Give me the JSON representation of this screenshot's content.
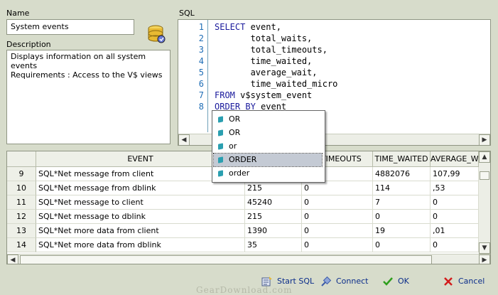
{
  "labels": {
    "name": "Name",
    "description": "Description",
    "sql": "SQL"
  },
  "name_value": "System events",
  "description_lines": [
    "Displays information on all system events",
    "Requirements : Access to the V$ views"
  ],
  "sql_lines": [
    {
      "num": "1",
      "kw": "SELECT",
      "rest": " event,"
    },
    {
      "num": "2",
      "kw": "",
      "rest": "       total_waits,"
    },
    {
      "num": "3",
      "kw": "",
      "rest": "       total_timeouts,"
    },
    {
      "num": "4",
      "kw": "",
      "rest": "       time_waited,"
    },
    {
      "num": "5",
      "kw": "",
      "rest": "       average_wait,"
    },
    {
      "num": "6",
      "kw": "",
      "rest": "       time_waited_micro"
    },
    {
      "num": "7",
      "kw": "FROM",
      "rest": " v$system_event"
    },
    {
      "num": "8",
      "kw": "ORDER BY",
      "rest": " event"
    }
  ],
  "grid": {
    "headers": [
      "",
      "EVENT",
      "",
      "L_TIMEOUTS",
      "TIME_WAITED",
      "AVERAGE_W"
    ],
    "rows": [
      {
        "n": "9",
        "cells": [
          "SQL*Net message from client",
          "",
          "",
          "4882076",
          "107,99"
        ]
      },
      {
        "n": "10",
        "cells": [
          "SQL*Net message from dblink",
          "215",
          "0",
          "114",
          ",53"
        ]
      },
      {
        "n": "11",
        "cells": [
          "SQL*Net message to client",
          "45240",
          "0",
          "7",
          "0"
        ]
      },
      {
        "n": "12",
        "cells": [
          "SQL*Net message to dblink",
          "215",
          "0",
          "0",
          "0"
        ]
      },
      {
        "n": "13",
        "cells": [
          "SQL*Net more data from client",
          "1390",
          "0",
          "19",
          ",01"
        ]
      },
      {
        "n": "14",
        "cells": [
          "SQL*Net more data from dblink",
          "35",
          "0",
          "0",
          "0"
        ]
      }
    ]
  },
  "popup_items": [
    "OR",
    "OR",
    "or",
    "ORDER",
    "order"
  ],
  "popup_selected": 3,
  "buttons": {
    "start_sql": "Start SQL",
    "connect": "Connect",
    "ok": "OK",
    "cancel": "Cancel"
  },
  "icons": {
    "database": "database-icon",
    "start_sql": "start-sql-icon",
    "connect": "connect-icon",
    "ok": "checkmark-icon",
    "cancel": "x-icon"
  },
  "colors": {
    "background": "#d7dccb",
    "keyword": "#1a1a9c",
    "line_number": "#1e6db6",
    "button_text": "#0a2c8a",
    "ok_green": "#2e9e1c",
    "cancel_red": "#d21c1c"
  },
  "watermark": "GearDownload.com"
}
